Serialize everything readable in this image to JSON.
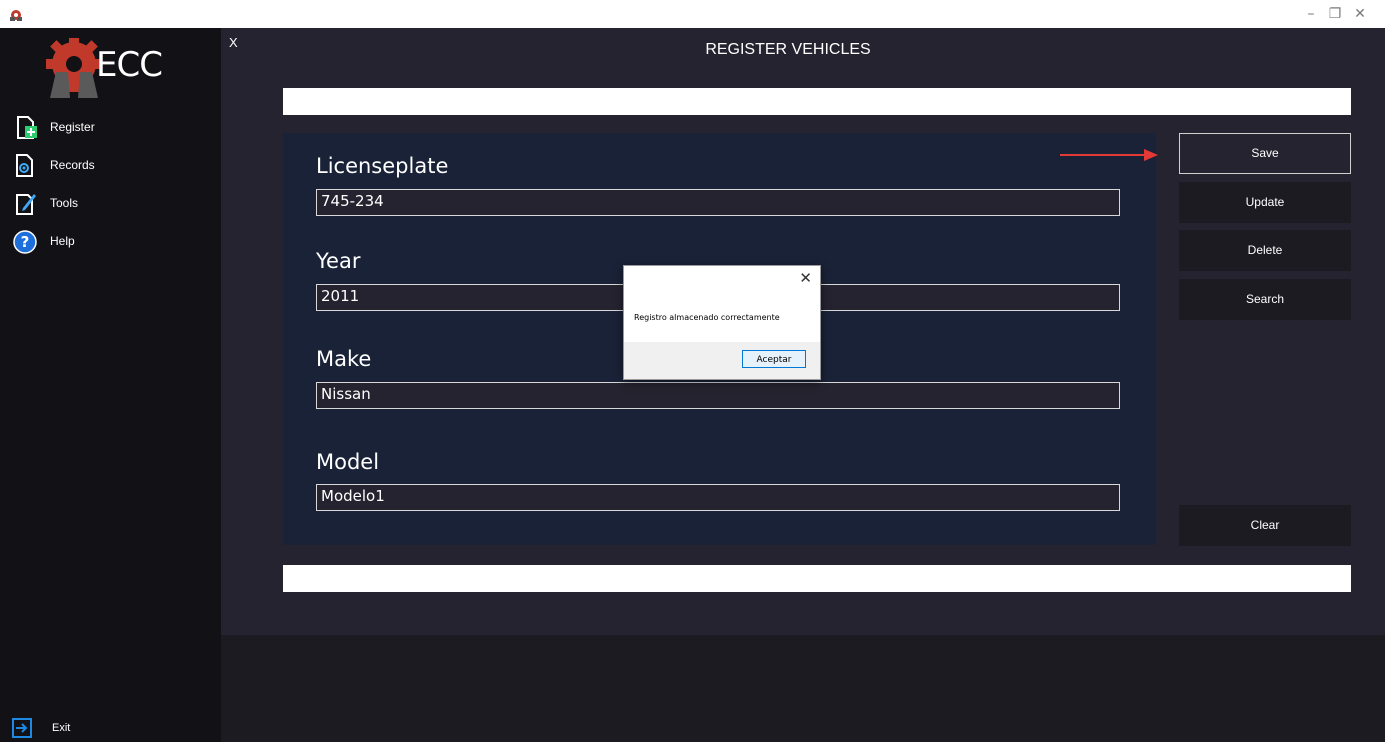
{
  "window": {
    "minimize": "–",
    "maximize": "❐",
    "close": "✕"
  },
  "sidebar": {
    "logo_text": "ECC",
    "items": [
      {
        "label": "Register",
        "icon": "register-icon"
      },
      {
        "label": "Records",
        "icon": "records-icon"
      },
      {
        "label": "Tools",
        "icon": "tools-icon"
      },
      {
        "label": "Help",
        "icon": "help-icon"
      }
    ],
    "exit_label": "Exit"
  },
  "main": {
    "close_label": "X",
    "title": "REGISTER VEHICLES",
    "fields": [
      {
        "label": "Licenseplate",
        "value": "745-234"
      },
      {
        "label": "Year",
        "value": "2011"
      },
      {
        "label": "Make",
        "value": "Nissan"
      },
      {
        "label": "Model",
        "value": "Modelo1"
      }
    ],
    "buttons": {
      "save": "Save",
      "update": "Update",
      "delete": "Delete",
      "search": "Search",
      "clear": "Clear"
    }
  },
  "dialog": {
    "close": "✕",
    "message": "Registro almacenado correctamente",
    "ok_label": "Aceptar"
  },
  "colors": {
    "accent_red": "#c0392b",
    "arrow": "#e53935",
    "panel": "#1a2238",
    "help_blue": "#1e6fd9",
    "exit_blue": "#1e88e5"
  }
}
